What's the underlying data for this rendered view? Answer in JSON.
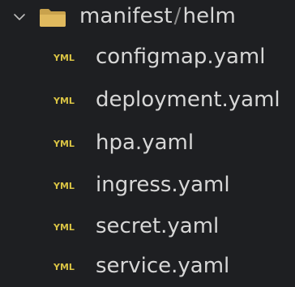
{
  "explorer": {
    "folder": {
      "name": "manifest",
      "separator": "/",
      "subname": "helm",
      "expanded": true,
      "chevron_icon": "chevron-down-icon",
      "folder_icon": "folder-icon",
      "folder_color": "#d7b15a"
    },
    "file_icon": "yaml-file-icon",
    "file_icon_text": "YML",
    "file_icon_color": "#d9c344",
    "files": [
      {
        "label": "configmap.yaml"
      },
      {
        "label": "deployment.yaml"
      },
      {
        "label": "hpa.yaml"
      },
      {
        "label": "ingress.yaml"
      },
      {
        "label": "secret.yaml"
      },
      {
        "label": "service.yaml"
      }
    ]
  }
}
